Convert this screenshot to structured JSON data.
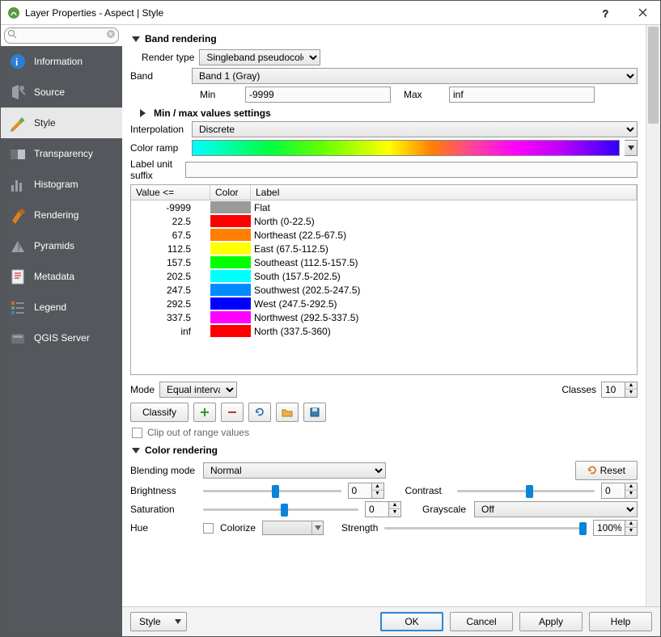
{
  "window": {
    "title": "Layer Properties - Aspect | Style"
  },
  "sidebar": {
    "items": [
      {
        "key": "information",
        "label": "Information"
      },
      {
        "key": "source",
        "label": "Source"
      },
      {
        "key": "style",
        "label": "Style"
      },
      {
        "key": "transparency",
        "label": "Transparency"
      },
      {
        "key": "histogram",
        "label": "Histogram"
      },
      {
        "key": "rendering",
        "label": "Rendering"
      },
      {
        "key": "pyramids",
        "label": "Pyramids"
      },
      {
        "key": "metadata",
        "label": "Metadata"
      },
      {
        "key": "legend",
        "label": "Legend"
      },
      {
        "key": "qgisserver",
        "label": "QGIS Server"
      }
    ],
    "active": "style",
    "search_placeholder": ""
  },
  "band_rendering": {
    "header": "Band rendering",
    "render_type_label": "Render type",
    "render_type_value": "Singleband pseudocolor",
    "band_label": "Band",
    "band_value": "Band 1 (Gray)",
    "min_label": "Min",
    "min_value": "-9999",
    "max_label": "Max",
    "max_value": "inf",
    "minmax_settings_label": "Min / max values settings",
    "interpolation_label": "Interpolation",
    "interpolation_value": "Discrete",
    "colorramp_label": "Color ramp",
    "label_unit_suffix_label": "Label unit suffix",
    "label_unit_suffix_value": "",
    "table_headers": {
      "value": "Value <=",
      "color": "Color",
      "label": "Label"
    },
    "rows": [
      {
        "value": "-9999",
        "color": "#9a9a9a",
        "label": "Flat"
      },
      {
        "value": "22.5",
        "color": "#ff0000",
        "label": "North (0-22.5)"
      },
      {
        "value": "67.5",
        "color": "#ff8000",
        "label": "Northeast (22.5-67.5)"
      },
      {
        "value": "112.5",
        "color": "#ffff00",
        "label": "East (67.5-112.5)"
      },
      {
        "value": "157.5",
        "color": "#00ff00",
        "label": "Southeast (112.5-157.5)"
      },
      {
        "value": "202.5",
        "color": "#00ffff",
        "label": "South (157.5-202.5)"
      },
      {
        "value": "247.5",
        "color": "#008cff",
        "label": "Southwest (202.5-247.5)"
      },
      {
        "value": "292.5",
        "color": "#0000ff",
        "label": "West (247.5-292.5)"
      },
      {
        "value": "337.5",
        "color": "#ff00ff",
        "label": "Northwest (292.5-337.5)"
      },
      {
        "value": "inf",
        "color": "#ff0000",
        "label": "North (337.5-360)"
      }
    ],
    "mode_label": "Mode",
    "mode_value": "Equal interval",
    "classes_label": "Classes",
    "classes_value": "10",
    "classify_label": "Classify",
    "clip_label": "Clip out of range values"
  },
  "color_rendering": {
    "header": "Color rendering",
    "blending_mode_label": "Blending mode",
    "blending_mode_value": "Normal",
    "reset_label": "Reset",
    "brightness_label": "Brightness",
    "brightness_value": "0",
    "contrast_label": "Contrast",
    "contrast_value": "0",
    "saturation_label": "Saturation",
    "saturation_value": "0",
    "grayscale_label": "Grayscale",
    "grayscale_value": "Off",
    "hue_label": "Hue",
    "colorize_label": "Colorize",
    "strength_label": "Strength",
    "strength_value": "100%"
  },
  "footer": {
    "style_menu": "Style",
    "ok": "OK",
    "cancel": "Cancel",
    "apply": "Apply",
    "help": "Help"
  }
}
